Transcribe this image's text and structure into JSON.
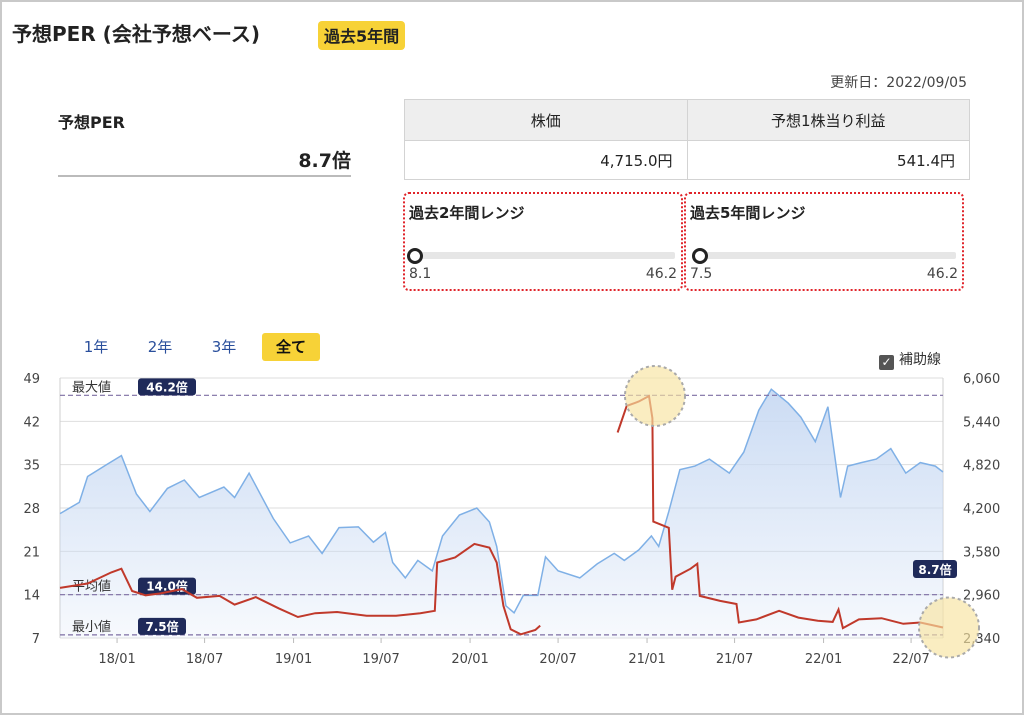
{
  "header": {
    "title": "予想PER (会社予想ベース)",
    "badge": "過去5年間",
    "updated": "更新日：2022/09/05"
  },
  "per": {
    "label": "予想PER",
    "value": "8.7倍"
  },
  "info_table": {
    "headers": [
      "株価",
      "予想1株当り利益"
    ],
    "values": [
      "4,715.0円",
      "541.4円"
    ]
  },
  "ranges": [
    {
      "title": "過去2年間レンジ",
      "min": "8.1",
      "max": "46.2",
      "current_fraction": 0.016
    },
    {
      "title": "過去5年間レンジ",
      "min": "7.5",
      "max": "46.2",
      "current_fraction": 0.031
    }
  ],
  "tabs": [
    "1年",
    "2年",
    "3年",
    "全て"
  ],
  "active_tab": "全て",
  "aux_checkbox": {
    "label": "補助線",
    "checked": true
  },
  "colors": {
    "per_line": "#c0392b",
    "price_line": "#7fb0e6",
    "price_fill": "#c9daf3",
    "badge": "#f7d237",
    "ref_line": "#7d6ea3",
    "label_bg": "#1f2a5a",
    "range_border": "#e0242a",
    "highlight": "#f7e3a0"
  },
  "chart_data": {
    "type": "line",
    "x_ticks": [
      "18/01",
      "18/07",
      "19/01",
      "19/07",
      "20/01",
      "20/07",
      "21/01",
      "21/07",
      "22/01",
      "22/07"
    ],
    "y_left": {
      "ticks": [
        49,
        42,
        35,
        28,
        21,
        14,
        7
      ],
      "range": [
        7,
        49
      ]
    },
    "y_right": {
      "ticks": [
        "6,060",
        "5,440",
        "4,820",
        "4,200",
        "3,580",
        "2,960",
        "2,340"
      ],
      "range": [
        2340,
        6060
      ]
    },
    "reference_lines": [
      {
        "label": "最大値",
        "value_label": "46.2倍",
        "value": 46.2
      },
      {
        "label": "平均値",
        "value_label": "14.0倍",
        "value": 14.0
      },
      {
        "label": "最小値",
        "value_label": "7.5倍",
        "value": 7.5
      }
    ],
    "current_label": "8.7倍",
    "per_series": [
      [
        "2017-09-05",
        15.1
      ],
      [
        "2017-11-01",
        15.8
      ],
      [
        "2017-12-20",
        17.6
      ],
      [
        "2018-01-10",
        18.2
      ],
      [
        "2018-02-01",
        14.6
      ],
      [
        "2018-03-01",
        13.9
      ],
      [
        "2018-04-01",
        14.2
      ],
      [
        "2018-05-15",
        14.9
      ],
      [
        "2018-06-15",
        13.5
      ],
      [
        "2018-08-01",
        13.8
      ],
      [
        "2018-09-01",
        12.4
      ],
      [
        "2018-10-15",
        13.6
      ],
      [
        "2018-12-01",
        11.8
      ],
      [
        "2019-01-10",
        10.4
      ],
      [
        "2019-02-15",
        11.0
      ],
      [
        "2019-04-01",
        11.2
      ],
      [
        "2019-06-01",
        10.6
      ],
      [
        "2019-08-01",
        10.6
      ],
      [
        "2019-09-20",
        11.0
      ],
      [
        "2019-10-20",
        11.4
      ],
      [
        "2019-10-25",
        19.2
      ],
      [
        "2019-12-01",
        20.0
      ],
      [
        "2020-01-10",
        22.2
      ],
      [
        "2020-02-10",
        21.6
      ],
      [
        "2020-02-25",
        19.2
      ],
      [
        "2020-03-10",
        12.2
      ],
      [
        "2020-03-25",
        8.4
      ],
      [
        "2020-04-15",
        7.6
      ],
      [
        "2020-05-15",
        8.3
      ],
      [
        "2020-05-25",
        9.0
      ],
      null,
      [
        "2020-11-01",
        40.2
      ],
      [
        "2020-11-20",
        44.5
      ],
      [
        "2020-12-15",
        45.2
      ],
      [
        "2021-01-05",
        46.1
      ],
      [
        "2021-01-12",
        42.5
      ],
      [
        "2021-01-14",
        25.8
      ],
      [
        "2021-02-15",
        24.8
      ],
      [
        "2021-02-22",
        14.8
      ],
      [
        "2021-03-01",
        16.9
      ],
      [
        "2021-04-01",
        18.2
      ],
      [
        "2021-04-15",
        19.0
      ],
      [
        "2021-04-20",
        13.8
      ],
      [
        "2021-06-01",
        13.0
      ],
      [
        "2021-07-05",
        12.5
      ],
      [
        "2021-07-10",
        9.5
      ],
      [
        "2021-08-15",
        10.0
      ],
      [
        "2021-10-01",
        11.4
      ],
      [
        "2021-11-10",
        10.3
      ],
      [
        "2021-12-20",
        9.8
      ],
      [
        "2022-01-20",
        9.6
      ],
      [
        "2022-02-01",
        11.6
      ],
      [
        "2022-02-10",
        8.6
      ],
      [
        "2022-03-15",
        10.0
      ],
      [
        "2022-05-01",
        10.2
      ],
      [
        "2022-06-15",
        9.3
      ],
      [
        "2022-07-20",
        9.5
      ],
      [
        "2022-09-05",
        8.7
      ]
    ],
    "price_series": [
      [
        "2017-09-05",
        4120
      ],
      [
        "2017-10-15",
        4280
      ],
      [
        "2017-11-01",
        4650
      ],
      [
        "2017-12-10",
        4820
      ],
      [
        "2018-01-10",
        4950
      ],
      [
        "2018-02-10",
        4400
      ],
      [
        "2018-03-10",
        4150
      ],
      [
        "2018-04-15",
        4480
      ],
      [
        "2018-05-20",
        4600
      ],
      [
        "2018-06-20",
        4350
      ],
      [
        "2018-08-10",
        4500
      ],
      [
        "2018-09-01",
        4350
      ],
      [
        "2018-10-01",
        4700
      ],
      [
        "2018-11-20",
        4050
      ],
      [
        "2018-12-25",
        3700
      ],
      [
        "2019-02-01",
        3800
      ],
      [
        "2019-03-01",
        3550
      ],
      [
        "2019-04-05",
        3920
      ],
      [
        "2019-05-15",
        3930
      ],
      [
        "2019-06-15",
        3710
      ],
      [
        "2019-07-10",
        3850
      ],
      [
        "2019-07-25",
        3420
      ],
      [
        "2019-08-20",
        3200
      ],
      [
        "2019-09-15",
        3450
      ],
      [
        "2019-10-15",
        3300
      ],
      [
        "2019-11-05",
        3800
      ],
      [
        "2019-12-10",
        4100
      ],
      [
        "2020-01-15",
        4200
      ],
      [
        "2020-02-10",
        4000
      ],
      [
        "2020-02-25",
        3650
      ],
      [
        "2020-03-15",
        2800
      ],
      [
        "2020-04-01",
        2700
      ],
      [
        "2020-04-20",
        2950
      ],
      [
        "2020-05-20",
        2950
      ],
      [
        "2020-06-05",
        3500
      ],
      [
        "2020-07-01",
        3300
      ],
      [
        "2020-08-15",
        3200
      ],
      [
        "2020-09-20",
        3400
      ],
      [
        "2020-10-25",
        3550
      ],
      [
        "2020-11-15",
        3450
      ],
      [
        "2020-12-15",
        3600
      ],
      [
        "2021-01-10",
        3800
      ],
      [
        "2021-01-25",
        3650
      ],
      [
        "2021-02-15",
        4150
      ],
      [
        "2021-03-10",
        4750
      ],
      [
        "2021-04-10",
        4800
      ],
      [
        "2021-05-10",
        4900
      ],
      [
        "2021-06-20",
        4700
      ],
      [
        "2021-07-20",
        5000
      ],
      [
        "2021-08-20",
        5600
      ],
      [
        "2021-09-15",
        5900
      ],
      [
        "2021-10-20",
        5700
      ],
      [
        "2021-11-15",
        5500
      ],
      [
        "2021-12-15",
        5150
      ],
      [
        "2022-01-10",
        5650
      ],
      [
        "2022-01-25",
        4900
      ],
      [
        "2022-02-05",
        4350
      ],
      [
        "2022-02-20",
        4800
      ],
      [
        "2022-03-20",
        4850
      ],
      [
        "2022-04-20",
        4900
      ],
      [
        "2022-05-20",
        5050
      ],
      [
        "2022-06-20",
        4700
      ],
      [
        "2022-07-20",
        4850
      ],
      [
        "2022-08-20",
        4800
      ],
      [
        "2022-09-05",
        4715
      ]
    ],
    "x_domain": [
      "2017-09-05",
      "2022-09-05"
    ],
    "highlights": [
      "peak",
      "current"
    ],
    "grid": true
  }
}
